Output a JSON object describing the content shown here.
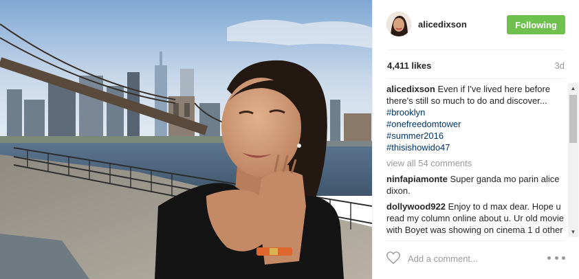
{
  "post": {
    "username": "alicedixson",
    "follow_label": "Following",
    "likes": "4,411 likes",
    "time_ago": "3d"
  },
  "caption": {
    "username": "alicedixson",
    "text": "Even if I've lived here before there's still so much to do and discover...",
    "hashtags": [
      "#brooklyn",
      "#onefreedomtower",
      "#summer2016",
      "#thisishowido47"
    ]
  },
  "view_all": "view all 54 comments",
  "comments": [
    {
      "username": "ninfapiamonte",
      "text": "Super ganda mo parin alice dixon."
    },
    {
      "username": "dollywood922",
      "text": "Enjoy to d max dear. Hope u read my column online about u. Ur old movie with Boyet was showing on cinema 1 d other night. Will send u screen shots 😀mmmmmmwaaaaaah😘"
    }
  ],
  "input": {
    "placeholder": "Add a comment..."
  },
  "icons": {
    "heart": "heart-outline-icon",
    "more": "more-options-icon",
    "scroll_up": "scroll-up-arrow-icon",
    "scroll_down": "scroll-down-arrow-icon"
  },
  "colors": {
    "follow_button": "#70c050",
    "hashtag": "#003569",
    "muted": "#999999",
    "text": "#262626"
  }
}
